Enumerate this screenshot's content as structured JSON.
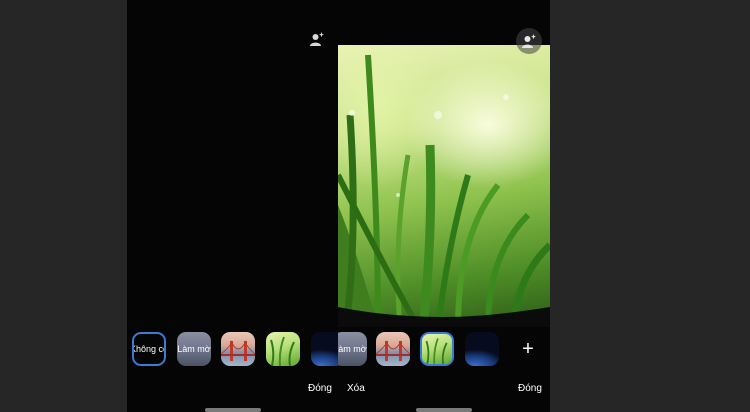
{
  "left_panel": {
    "effects_icon": "person-sparkle-icon",
    "thumbnails": [
      {
        "kind": "none",
        "label": "Không có"
      },
      {
        "kind": "blur",
        "label": "Làm mờ"
      },
      {
        "kind": "bridge",
        "label": ""
      },
      {
        "kind": "grass",
        "label": ""
      },
      {
        "kind": "earth",
        "label": ""
      }
    ],
    "close_label": "Đóng"
  },
  "right_panel": {
    "effects_icon": "person-sparkle-icon",
    "thumbnails": [
      {
        "kind": "blur",
        "label": "Làm mờ"
      },
      {
        "kind": "bridge",
        "label": ""
      },
      {
        "kind": "grass",
        "label": "",
        "selected": true
      },
      {
        "kind": "earth",
        "label": ""
      }
    ],
    "add_label": "+",
    "delete_label": "Xóa",
    "close_label": "Đóng"
  },
  "colors": {
    "accent": "#3a7bd5",
    "phone_bg": "#050505",
    "page_bg": "#262626"
  }
}
